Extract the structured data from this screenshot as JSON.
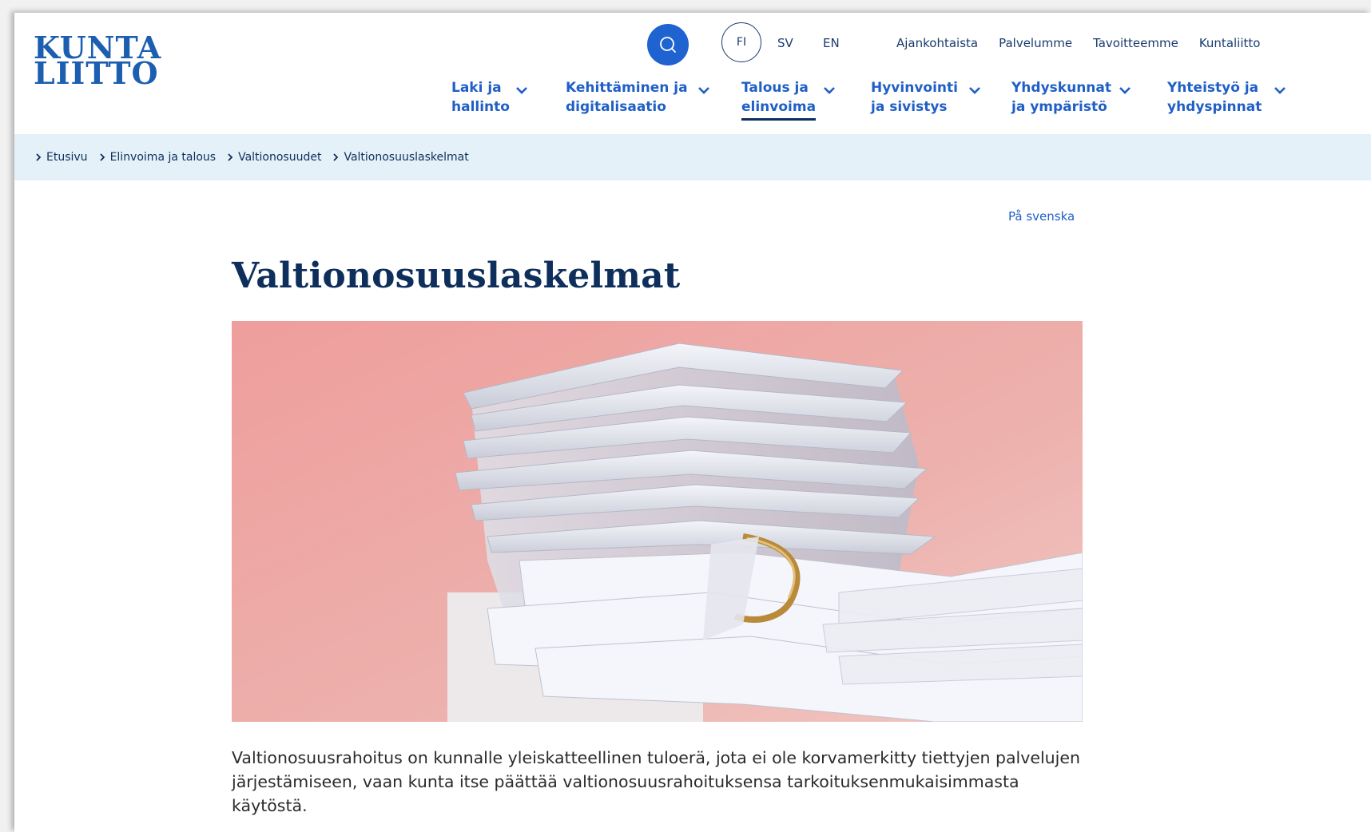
{
  "header": {
    "logo": {
      "line1": "KUNTA",
      "line2": "LIITTO"
    },
    "languages": {
      "active": "FI",
      "sv": "SV",
      "en": "EN"
    },
    "top_links": [
      "Ajankohtaista",
      "Palvelumme",
      "Tavoitteemme",
      "Kuntaliitto"
    ],
    "main_nav": [
      {
        "line1": "Laki ja",
        "line2": "hallinto",
        "active": false
      },
      {
        "line1": "Kehittäminen ja",
        "line2": "digitalisaatio",
        "active": false
      },
      {
        "line1": "Talous ja",
        "line2": "elinvoima",
        "active": true
      },
      {
        "line1": "Hyvinvointi",
        "line2": "ja sivistys",
        "active": false
      },
      {
        "line1": "Yhdyskunnat",
        "line2": "ja ympäristö",
        "active": false
      },
      {
        "line1": "Yhteistyö ja",
        "line2": "yhdyspinnat",
        "active": false
      }
    ]
  },
  "breadcrumb": [
    "Etusivu",
    "Elinvoima ja talous",
    "Valtionosuudet",
    "Valtionosuuslaskelmat"
  ],
  "content": {
    "language_link": "På svenska",
    "title": "Valtionosuuslaskelmat",
    "intro": "Valtionosuusrahoitus on kunnalle yleiskatteellinen tuloerä, jota ei ole korvamerkitty tiettyjen palvelujen järjestämiseen, vaan kunta itse päättää valtionosuusrahoituksensa tarkoituksenmukaisimmasta käytöstä."
  },
  "colors": {
    "brand_blue": "#1f63d0",
    "nav_blue": "#1f5fc6",
    "dark_navy": "#0e2f5c",
    "breadcrumb_bg": "#e4f1f8",
    "hero_pink": "#e9aaa5"
  },
  "icons": {
    "search": "search-icon",
    "nav_chevron": "chevron-down-icon",
    "breadcrumb_separator": "chevron-right-icon"
  }
}
